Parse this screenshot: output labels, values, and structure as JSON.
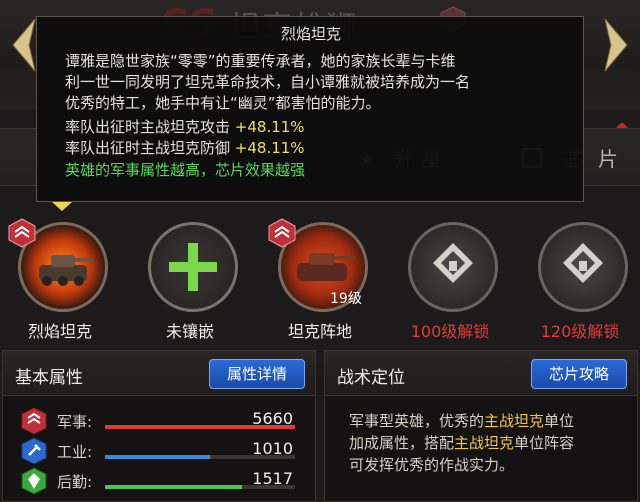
{
  "header": {
    "hero_name": "坦克雄狮",
    "rank_badge": "SS",
    "right_dot_color": "#e01818"
  },
  "tabs": [
    {
      "label": "升星",
      "icon": "star-icon"
    },
    {
      "label": "芯片",
      "icon": "chip-icon"
    }
  ],
  "tooltip": {
    "title": "烈焰坦克",
    "lines": [
      "谭雅是隐世家族“零零”的重要传承者，她的家族长辈与卡维",
      "利一世一同发明了坦克革命技术，自小谭雅就被培养成为一名",
      "优秀的特工，她手中有让“幽灵”都害怕的能力。"
    ],
    "bonus_attack_label": "率队出征时主战坦克攻击",
    "bonus_attack_value": "+48.11%",
    "bonus_defense_label": "率队出征时主战坦克防御",
    "bonus_defense_value": "+48.11%",
    "note": "英雄的军事属性越高，芯片效果越强"
  },
  "slots": [
    {
      "label": "烈焰坦克",
      "state": "equipped",
      "icon": "flame-tank-icon"
    },
    {
      "label": "未镶嵌",
      "state": "empty",
      "icon": "plus-icon"
    },
    {
      "label": "坦克阵地",
      "state": "equipped",
      "icon": "tank-base-icon",
      "level": "19级"
    },
    {
      "label": "100级解锁",
      "state": "locked",
      "icon": "lock-icon"
    },
    {
      "label": "120级解锁",
      "state": "locked",
      "icon": "lock-icon"
    }
  ],
  "basic": {
    "title": "基本属性",
    "button": "属性详情",
    "attrs": [
      {
        "label": "军事:",
        "value": "5660",
        "fill": 1.0,
        "color": "#e03a3a",
        "icon": "military-icon"
      },
      {
        "label": "工业:",
        "value": "1010",
        "fill": 0.55,
        "color": "#3a8ae0",
        "icon": "industry-icon"
      },
      {
        "label": "后勤:",
        "value": "1517",
        "fill": 0.72,
        "color": "#4ac84a",
        "icon": "logistics-icon"
      }
    ]
  },
  "tactics": {
    "title": "战术定位",
    "button": "芯片攻略",
    "line1_a": "军事型英雄，优秀的",
    "line1_hl": "主战坦克",
    "line1_b": "单位",
    "line2_a": "加成属性，搭配",
    "line2_hl": "主战坦克",
    "line2_b": "单位阵容",
    "line3": "可发挥优秀的作战实力。"
  }
}
